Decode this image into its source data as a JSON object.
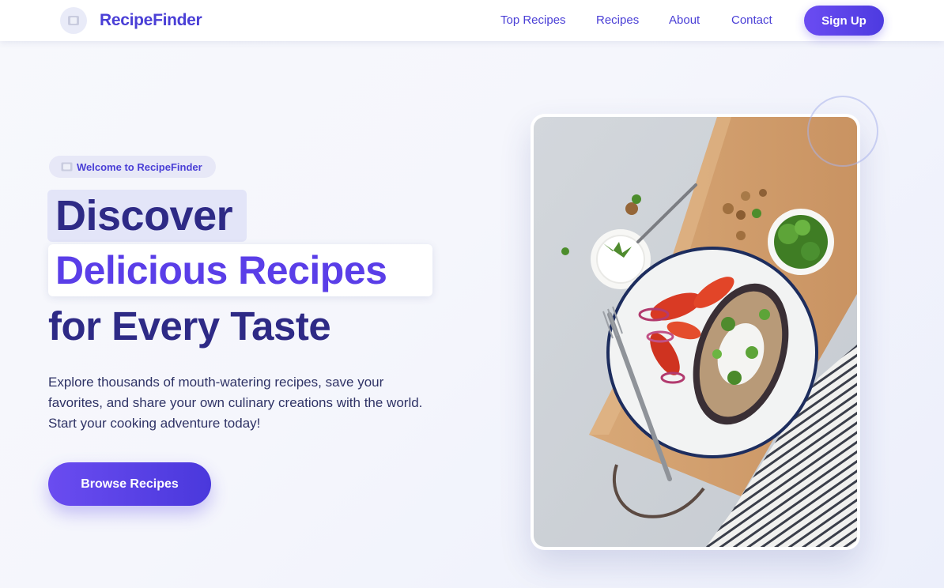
{
  "nav": {
    "brand_name": "RecipeFinder",
    "links": [
      "Top Recipes",
      "Recipes",
      "About",
      "Contact"
    ],
    "signup_label": "Sign Up"
  },
  "hero": {
    "badge": "Welcome to RecipeFinder",
    "headline_line1": "Discover",
    "headline_line2": "Delicious Recipes",
    "headline_line3": "for Every Taste",
    "lead": "Explore thousands of mouth-watering recipes, save your favorites, and share your own culinary creations with the world. Start your cooking adventure today!",
    "cta_label": "Browse Recipes"
  },
  "colors": {
    "accent": "#5a3ee8",
    "heading_dark": "#2e2a86",
    "nav_link": "#4a3fd6",
    "background": "#f5f6fc"
  },
  "icons": {
    "brand": "plate-icon",
    "badge": "plate-icon"
  }
}
